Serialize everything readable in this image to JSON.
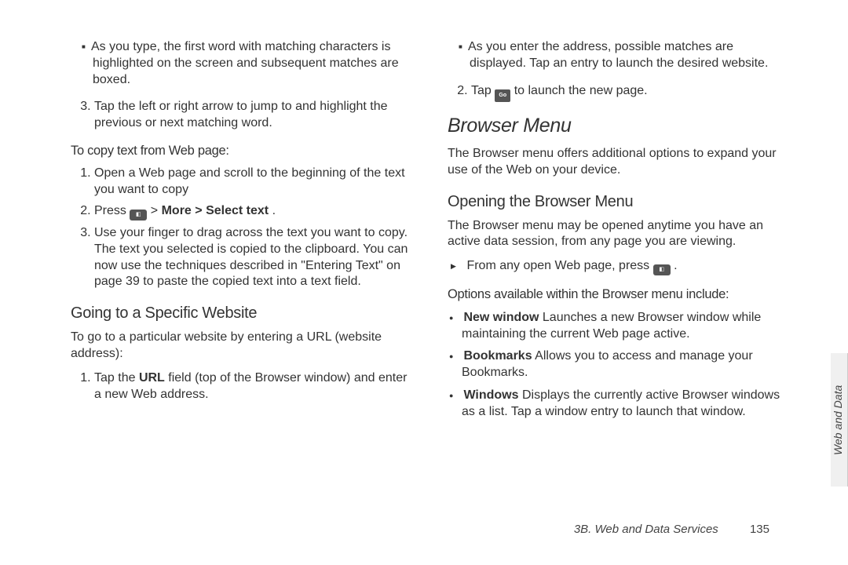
{
  "left": {
    "sub1": "As you type, the first word with matching characters is highlighted on the screen and subsequent matches are boxed.",
    "step3": "Tap the left or right arrow to jump to and highlight the previous or next matching word.",
    "copy_label": "To copy text from Web page:",
    "copy_step1": "Open a Web page and scroll to the beginning of the text you want to copy",
    "copy_step2_a": "Press ",
    "copy_step2_b": " > ",
    "copy_step2_more": "More",
    "copy_step2_gt": " > ",
    "copy_step2_select": "Select text",
    "copy_step2_end": ".",
    "copy_step3": "Use your finger to drag across the text you want to copy. The text you selected is copied to the clipboard. You can now use the techniques described in \"Entering Text\" on page 39 to paste the copied text into a text field.",
    "going_heading": "Going to a Specific Website",
    "going_intro": "To go to a particular website by entering a URL (website address):",
    "going_step1_a": "Tap the ",
    "going_step1_url": "URL",
    "going_step1_b": " field (top of the Browser window) and enter a new Web address."
  },
  "right": {
    "sub1": "As you enter the address, possible matches are displayed. Tap an entry to launch the desired website.",
    "step2_a": "Tap ",
    "go_label": "Go",
    "step2_b": " to launch the new page.",
    "menu_heading": "Browser Menu",
    "menu_intro": "The Browser menu offers additional options to expand your use of the Web on your device.",
    "open_heading": "Opening the Browser Menu",
    "open_intro": "The Browser menu may be opened anytime you have an active data session, from any page you are viewing.",
    "arrow_item_a": "From any open Web page, press ",
    "arrow_item_b": ".",
    "options_label": "Options available within the Browser menu include:",
    "opt_new_b": "New window",
    "opt_new_t": " Launches a new Browser window while maintaining the current Web page active.",
    "opt_book_b": "Bookmarks",
    "opt_book_t": " Allows you to access and manage your Bookmarks.",
    "opt_win_b": "Windows",
    "opt_win_t": " Displays the currently active Browser windows as a list. Tap a window entry to launch that window."
  },
  "side_tab": "Web and Data",
  "footer_section": "3B. Web and Data Services",
  "footer_page": "135"
}
